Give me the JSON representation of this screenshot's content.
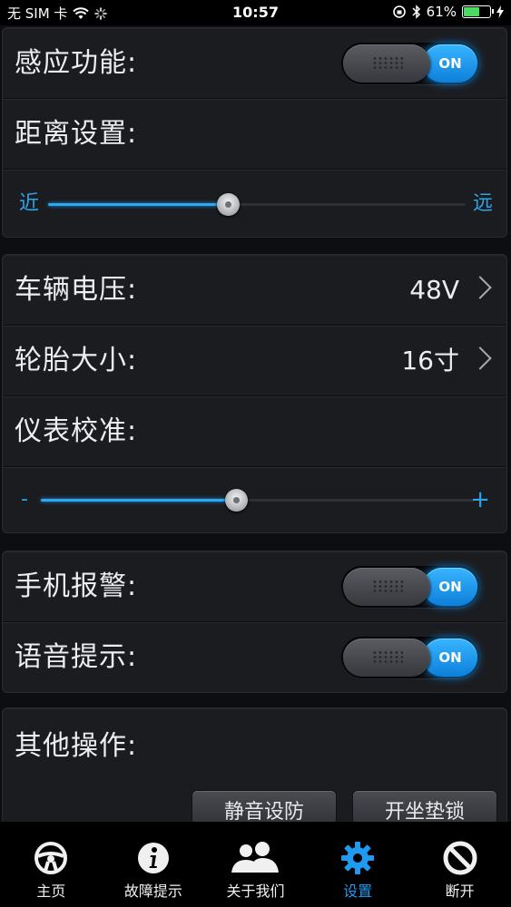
{
  "status_bar": {
    "carrier": "无 SIM 卡",
    "time": "10:57",
    "battery": "61%",
    "battery_level": 0.61
  },
  "sensing": {
    "label": "感应功能:",
    "toggle_label": "ON",
    "distance_label": "距离设置:",
    "slider_min_label": "近",
    "slider_max_label": "远",
    "slider_value": 0.43
  },
  "vehicle": {
    "voltage_label": "车辆电压:",
    "voltage_value": "48V",
    "tire_label": "轮胎大小:",
    "tire_value": "16寸",
    "calibration_label": "仪表校准:",
    "slider_min_label": "-",
    "slider_max_label": "+",
    "slider_value": 0.45
  },
  "alerts": {
    "phone_alarm_label": "手机报警:",
    "phone_alarm_toggle": "ON",
    "voice_label": "语音提示:",
    "voice_toggle": "ON"
  },
  "other_ops": {
    "title": "其他操作:",
    "buttons": [
      "静音设防",
      "开坐垫锁"
    ]
  },
  "tab_bar": {
    "items": [
      {
        "label": "主页",
        "icon": "steering-wheel-icon"
      },
      {
        "label": "故障提示",
        "icon": "info-icon"
      },
      {
        "label": "关于我们",
        "icon": "users-icon"
      },
      {
        "label": "设置",
        "icon": "gear-icon"
      },
      {
        "label": "断开",
        "icon": "disconnect-icon"
      }
    ],
    "active_index": 3,
    "accent_color": "#1e9af0"
  }
}
